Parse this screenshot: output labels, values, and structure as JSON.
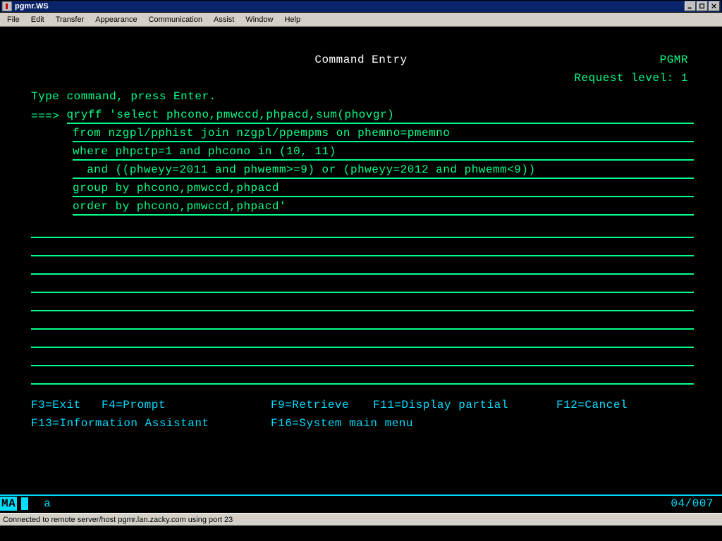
{
  "window": {
    "title": "pgmr.WS"
  },
  "menubar": [
    "File",
    "Edit",
    "Transfer",
    "Appearance",
    "Communication",
    "Assist",
    "Window",
    "Help"
  ],
  "screen": {
    "title": "Command Entry",
    "user": "PGMR",
    "request_label": "Request level:",
    "request_value": "1",
    "instruction": "Type command, press Enter.",
    "prompt": "===>",
    "command_lines": [
      "qryff 'select phcono,pmwccd,phpacd,sum(phovgr)",
      "from nzgpl/pphist join nzgpl/ppempms on phemno=pmemno",
      "where phpctp=1 and phcono in (10, 11)",
      "  and ((phweyy=2011 and phwemm>=9) or (phweyy=2012 and phwemm<9))",
      "group by phcono,pmwccd,phpacd",
      "order by phcono,pmwccd,phpacd'"
    ],
    "fkeys_row1": {
      "f3": "F3=Exit",
      "f4": "F4=Prompt",
      "f9": "F9=Retrieve",
      "f11": "F11=Display partial",
      "f12": "F12=Cancel"
    },
    "fkeys_row2": {
      "f13": "F13=Information Assistant",
      "f16": "F16=System main menu"
    }
  },
  "oia": {
    "ma": "MA",
    "a": "a",
    "position": "04/007"
  },
  "statusbar": "Connected to remote server/host pgmr.lan.zacky.com using port 23"
}
